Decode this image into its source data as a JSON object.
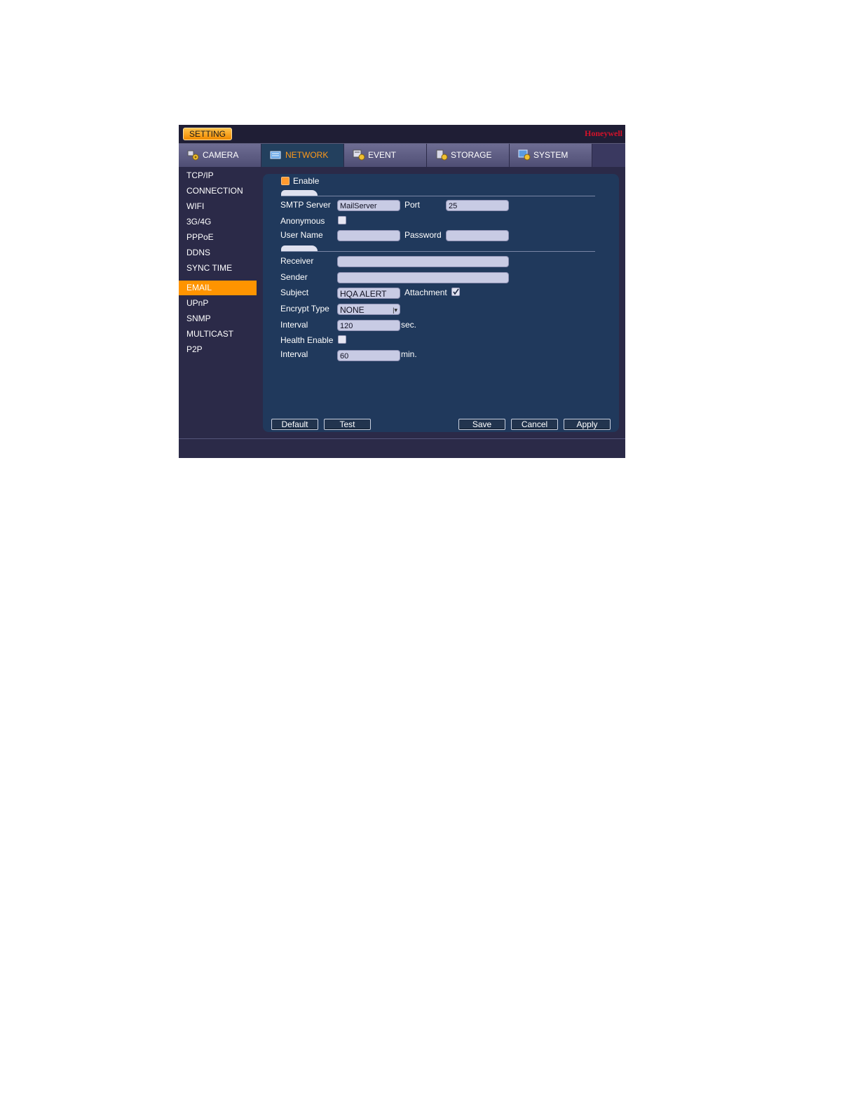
{
  "titlebar": {
    "badge": "SETTING",
    "brand": "Honeywell"
  },
  "tabs": [
    {
      "label": "CAMERA",
      "icon": "camera-gear-icon"
    },
    {
      "label": "NETWORK",
      "icon": "network-gear-icon"
    },
    {
      "label": "EVENT",
      "icon": "event-gear-icon"
    },
    {
      "label": "STORAGE",
      "icon": "storage-gear-icon"
    },
    {
      "label": "SYSTEM",
      "icon": "system-gear-icon"
    }
  ],
  "active_tab": "NETWORK",
  "sidebar": {
    "items": [
      {
        "label": "TCP/IP"
      },
      {
        "label": "CONNECTION"
      },
      {
        "label": "WIFI"
      },
      {
        "label": "3G/4G"
      },
      {
        "label": "PPPoE"
      },
      {
        "label": "DDNS"
      },
      {
        "label": "SYNC TIME"
      },
      {
        "label": "EMAIL"
      },
      {
        "label": "UPnP"
      },
      {
        "label": "SNMP"
      },
      {
        "label": "MULTICAST"
      },
      {
        "label": "P2P"
      }
    ],
    "active": "EMAIL"
  },
  "form": {
    "enable_label": "Enable",
    "smtp_label": "SMTP Server",
    "smtp_value": "MailServer",
    "port_label": "Port",
    "port_value": "25",
    "anonymous_label": "Anonymous",
    "username_label": "User Name",
    "username_value": "",
    "password_label": "Password",
    "password_value": "",
    "receiver_label": "Receiver",
    "receiver_value": "",
    "sender_label": "Sender",
    "sender_value": "",
    "subject_label": "Subject",
    "subject_value": "HQA ALERT",
    "attachment_label": "Attachment",
    "attachment_checked": true,
    "encrypt_label": "Encrypt Type",
    "encrypt_value": "NONE",
    "interval_label": "Interval",
    "interval_value": "120",
    "interval_unit": "sec.",
    "health_label": "Health Enable",
    "health_interval_label": "Interval",
    "health_interval_value": "60",
    "health_interval_unit": "min."
  },
  "buttons": {
    "default": "Default",
    "test": "Test",
    "save": "Save",
    "cancel": "Cancel",
    "apply": "Apply"
  },
  "colors": {
    "accent": "#ff9400",
    "panel": "#20395c",
    "brand": "#d4122a"
  }
}
